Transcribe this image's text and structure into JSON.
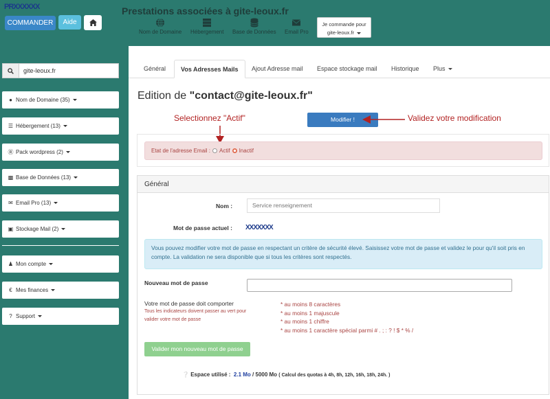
{
  "brand": {
    "scribble": "PRXXXXXX"
  },
  "buttons": {
    "commander": "COMMANDER",
    "aide": "Aide"
  },
  "title": "Prestations associées à gite-leoux.fr",
  "top_nav": [
    {
      "label": "Nom de Domaine",
      "icon": "globe-icon"
    },
    {
      "label": "Hébergement",
      "icon": "server-icon"
    },
    {
      "label": "Base de Données",
      "icon": "database-icon"
    },
    {
      "label": "Email Pro",
      "icon": "envelope-icon"
    }
  ],
  "commande": {
    "line1": "Je commande pour",
    "line2": "gite-leoux.fr"
  },
  "sidebar": {
    "search_value": "gite-leoux.fr",
    "items": [
      {
        "label": "Nom de Domaine (35)",
        "icon": "globe-icon"
      },
      {
        "label": "Hébergement (13)",
        "icon": "server-icon"
      },
      {
        "label": "Pack wordpress (2)",
        "icon": "wordpress-icon"
      },
      {
        "label": "Base de Données (13)",
        "icon": "database-icon"
      },
      {
        "label": "Email Pro (13)",
        "icon": "envelope-icon"
      },
      {
        "label": "Stockage Mail (2)",
        "icon": "archive-icon"
      },
      {
        "label": "Mon compte",
        "icon": "user-icon"
      },
      {
        "label": "Mes finances",
        "icon": "euro-icon"
      },
      {
        "label": "Support",
        "icon": "question-icon"
      }
    ]
  },
  "tabs": [
    {
      "label": "Général",
      "active": false
    },
    {
      "label": "Vos Adresses Mails",
      "active": true
    },
    {
      "label": "Ajout Adresse mail",
      "active": false
    },
    {
      "label": "Espace stockage mail",
      "active": false
    },
    {
      "label": "Historique",
      "active": false
    },
    {
      "label": "Plus",
      "active": false
    }
  ],
  "edit": {
    "prefix": "Edition de ",
    "email": "\"contact@gite-leoux.fr\""
  },
  "annotations": {
    "select_actif": "Selectionnez \"Actif\"",
    "validate": "Validez votre modification"
  },
  "modifier_label": "Modifier !",
  "etat": {
    "label": "Etat de l'adresse Email :",
    "actif": "Actif",
    "inactif": "Inactif",
    "selected": "Inactif"
  },
  "general": {
    "header": "Général",
    "nom_label": "Nom :",
    "nom_value": "Service renseignement",
    "pwd_label": "Mot de passe actuel :",
    "pwd_value": "XXXXXXX",
    "info": "Vous pouvez modifier votre mot de passe en respectant un critère de sécurité élevé. Saisissez votre mot de passe et validez le pour qu'il soit pris en compte. La validation ne sera disponible que si tous les critères sont respectés.",
    "new_pwd_label": "Nouveau mot de passe",
    "req_title": "Votre mot de passe doit comporter",
    "req_note1": "Tous les indicateurs doivent passer au vert pour",
    "req_note2": "valider votre mot de passe",
    "requirements": [
      "* au moins 8 caractères",
      "* au moins 1 majuscule",
      "* au moins 1 chiffre",
      "* au moins 1 caractère spécial parmi # . ; : ? ! $ * % /"
    ],
    "valider_label": "Valider mon nouveau mot de passe",
    "espace_label": "Espace utilisé :",
    "espace_used": "2.1 Mo",
    "espace_total": "/ 5000 Mo",
    "espace_note": "( Calcul des quotas à 4h, 8h, 12h, 16h, 18h, 24h. )"
  },
  "colors": {
    "background": "#2b7a6f",
    "primary": "#3a87c8",
    "info": "#5bc0de",
    "annotation": "#b22222"
  }
}
